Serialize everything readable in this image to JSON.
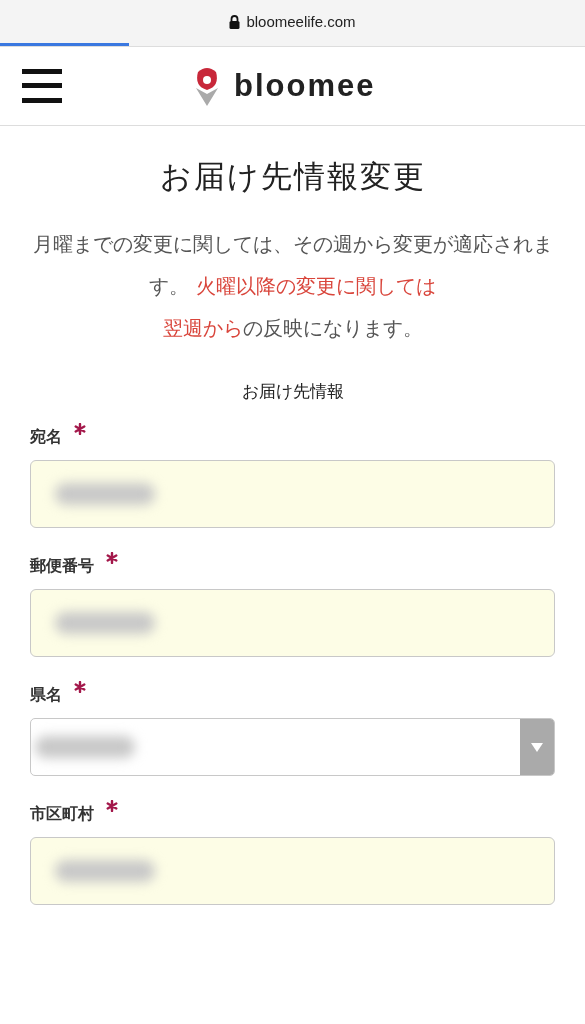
{
  "browser": {
    "url": "bloomeelife.com",
    "level": 0.22
  },
  "header": {
    "logo_text": "bloomee"
  },
  "title": "お届け先情報変更",
  "notice": {
    "lead": "月曜までの変更に関しては、その週から変更が適応されます。",
    "highlight": [
      "火曜以降の変更に関しては",
      "翌週から"
    ],
    "tail": "の反映になります。"
  },
  "section_title": "お届け先情報",
  "fields": [
    {
      "label": "宛名",
      "required": true,
      "kind": "text",
      "redacted": true
    },
    {
      "label": "郵便番号",
      "required": true,
      "kind": "text",
      "redacted": true
    },
    {
      "label": "県名",
      "required": true,
      "kind": "select",
      "redacted": true
    },
    {
      "label": "市区町村",
      "required": true,
      "kind": "text",
      "redacted": true
    }
  ]
}
